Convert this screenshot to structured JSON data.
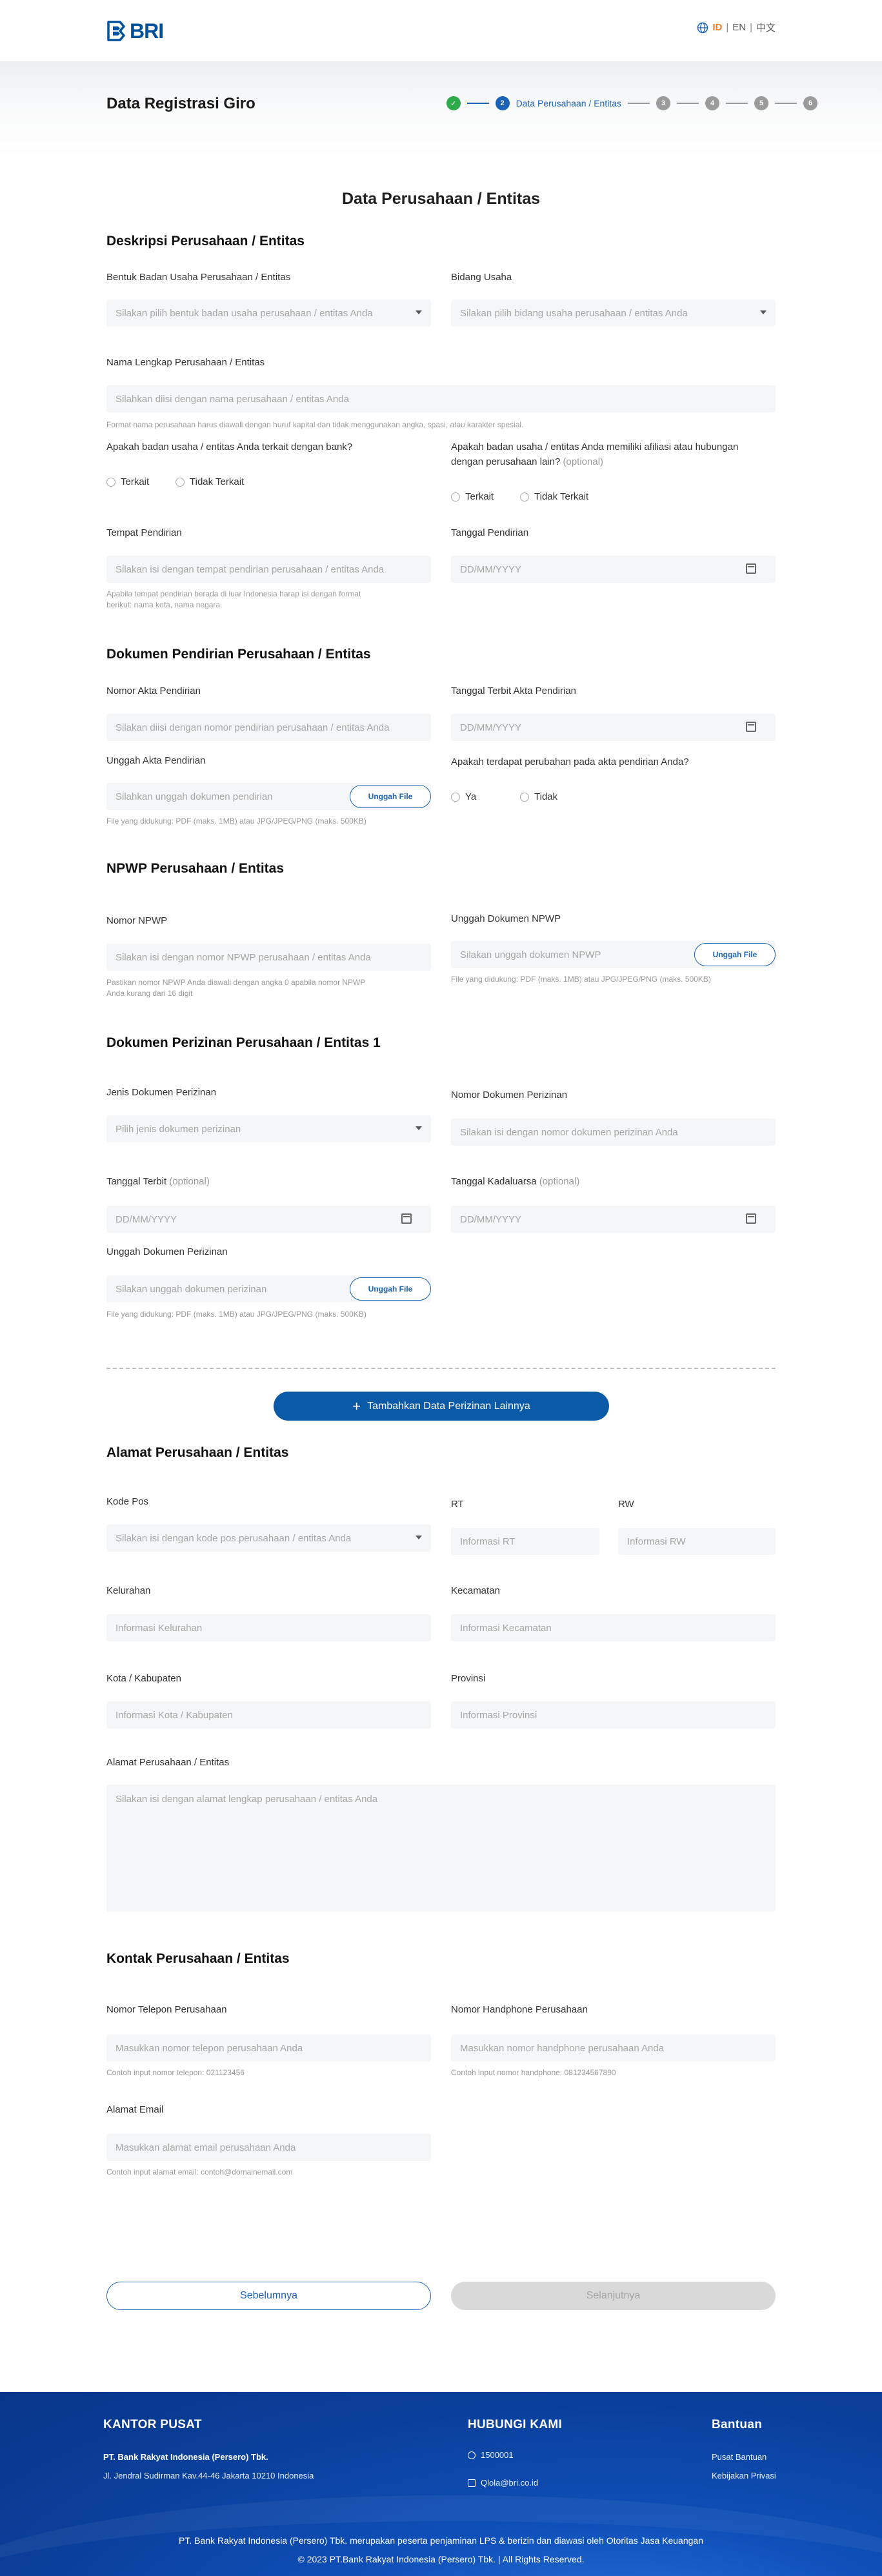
{
  "header": {
    "logo_text": "BRI",
    "lang_id": "ID",
    "lang_en": "EN",
    "lang_cn": "中文",
    "sep": "|"
  },
  "hero": {
    "title": "Data Registrasi Giro",
    "steps": [
      "✓",
      "2",
      "3",
      "4",
      "5",
      "6"
    ],
    "active_label": "Data Perusahaan / Entitas"
  },
  "page_title": "Data Perusahaan / Entitas",
  "s1": {
    "title": "Deskripsi Perusahaan / Entitas",
    "bentuk_label": "Bentuk Badan Usaha Perusahaan / Entitas",
    "bentuk_ph": "Silakan pilih bentuk badan usaha perusahaan / entitas Anda",
    "bidang_label": "Bidang Usaha",
    "bidang_ph": "Silakan pilih bidang usaha perusahaan / entitas Anda",
    "nama_label": "Nama Lengkap Perusahaan / Entitas",
    "nama_ph": "Silahkan diisi dengan nama perusahaan / entitas Anda",
    "nama_help": "Format nama perusahaan harus diawali dengan huruf kapital dan tidak menggunakan angka, spasi, atau karakter spesial.",
    "bank_q": "Apakah badan usaha / entitas Anda terkait dengan bank?",
    "bank_opt1": "Terkait",
    "bank_opt2": "Tidak Terkait",
    "afiliasi_q1": "Apakah badan usaha / entitas Anda memiliki afiliasi atau hubungan",
    "afiliasi_q2": "dengan perusahaan lain?",
    "afiliasi_opt": "(optional)",
    "afiliasi_opt1": "Terkait",
    "afiliasi_opt2": "Tidak Terkait",
    "tempat_label": "Tempat Pendirian",
    "tempat_ph": "Silakan isi dengan tempat pendirian perusahaan / entitas Anda",
    "tempat_help1": "Apabila tempat pendirian berada di luar Indonesia harap isi dengan format",
    "tempat_help2": "berikut: nama kota, nama negara.",
    "tanggal_label": "Tanggal Pendirian",
    "tanggal_ph": "DD/MM/YYYY"
  },
  "s2": {
    "title": "Dokumen Pendirian Perusahaan / Entitas",
    "nomor_label": "Nomor Akta Pendirian",
    "nomor_ph": "Silakan diisi dengan nomor pendirian perusahaan / entitas Anda",
    "terbit_label": "Tanggal Terbit Akta Pendirian",
    "terbit_ph": "DD/MM/YYYY",
    "unggah_label": "Unggah Akta Pendirian",
    "unggah_ph": "Silahkan unggah dokumen pendirian",
    "unggah_btn": "Unggah File",
    "unggah_help": "File yang didukung: PDF (maks. 1MB) atau JPG/JPEG/PNG (maks. 500KB)",
    "perubahan_q": "Apakah terdapat perubahan pada akta pendirian Anda?",
    "opt_ya": "Ya",
    "opt_tidak": "Tidak"
  },
  "s3": {
    "title": "NPWP Perusahaan / Entitas",
    "nomor_label": "Nomor NPWP",
    "nomor_ph": "Silakan isi dengan nomor NPWP perusahaan / entitas Anda",
    "nomor_help1": "Pastikan nomor NPWP Anda diawali dengan angka 0 apabila nomor NPWP",
    "nomor_help2": "Anda kurang dari 16 digit",
    "unggah_label": "Unggah Dokumen NPWP",
    "unggah_ph": "Silakan unggah dokumen NPWP",
    "unggah_btn": "Unggah File",
    "unggah_help": "File yang didukung: PDF (maks. 1MB) atau JPG/JPEG/PNG (maks. 500KB)"
  },
  "s4": {
    "title": "Dokumen Perizinan Perusahaan / Entitas 1",
    "jenis_label": "Jenis Dokumen Perizinan",
    "jenis_ph": "Pilih jenis dokumen perizinan",
    "nomor_label": "Nomor Dokumen Perizinan",
    "nomor_ph": "Silakan isi dengan nomor dokumen perizinan Anda",
    "terbit_label": "Tanggal Terbit",
    "kadaluarsa_label": "Tanggal Kadaluarsa",
    "optional": "(optional)",
    "date_ph": "DD/MM/YYYY",
    "unggah_label": "Unggah Dokumen Perizinan",
    "unggah_ph": "Silakan unggah dokumen perizinan",
    "unggah_btn": "Unggah File",
    "unggah_help": "File yang didukung: PDF (maks. 1MB) atau JPG/JPEG/PNG (maks. 500KB)",
    "add_btn": "Tambahkan Data Perizinan Lainnya"
  },
  "s5": {
    "title": "Alamat Perusahaan / Entitas",
    "kodepos_label": "Kode Pos",
    "kodepos_ph": "Silakan isi dengan kode pos perusahaan / entitas Anda",
    "rt_label": "RT",
    "rt_ph": "Informasi RT",
    "rw_label": "RW",
    "rw_ph": "Informasi RW",
    "kel_label": "Kelurahan",
    "kel_ph": "Informasi Kelurahan",
    "kec_label": "Kecamatan",
    "kec_ph": "Informasi Kecamatan",
    "kota_label": "Kota / Kabupaten",
    "kota_ph": "Informasi Kota / Kabupaten",
    "prov_label": "Provinsi",
    "prov_ph": "Informasi Provinsi",
    "alamat_label": "Alamat Perusahaan / Entitas",
    "alamat_ph": "Silakan isi dengan alamat lengkap perusahaan / entitas Anda"
  },
  "s6": {
    "title": "Kontak Perusahaan / Entitas",
    "telp_label": "Nomor Telepon Perusahaan",
    "telp_ph": "Masukkan nomor telepon perusahaan Anda",
    "telp_help": "Contoh input nomor telepon: 021123456",
    "hp_label": "Nomor Handphone Perusahaan",
    "hp_ph": "Masukkan nomor handphone perusahaan Anda",
    "hp_help": "Contoh input nomor handphone: 081234567890",
    "email_label": "Alamat Email",
    "email_ph": "Masukkan alamat email perusahaan Anda",
    "email_help": "Contoh input alamat email: contoh@domainemail.com"
  },
  "nav": {
    "prev": "Sebelumnya",
    "next": "Selanjutnya"
  },
  "footer": {
    "kantor_title": "KANTOR PUSAT",
    "kantor_name": "PT. Bank Rakyat Indonesia (Persero) Tbk.",
    "kantor_addr": "Jl. Jendral Sudirman Kav.44-46 Jakarta 10210 Indonesia",
    "hubungi_title": "HUBUNGI KAMI",
    "phone": "1500001",
    "email": "Qlola@bri.co.id",
    "bantuan_title": "Bantuan",
    "pusat_bantuan": "Pusat Bantuan",
    "kebijakan": "Kebijakan Privasi",
    "disclaimer": "PT. Bank Rakyat Indonesia (Persero) Tbk. merupakan peserta penjaminan LPS & berizin dan diawasi oleh Otoritas Jasa Keuangan",
    "copyright": "© 2023 PT.Bank Rakyat Indonesia (Persero) Tbk. | All Rights Reserved."
  }
}
